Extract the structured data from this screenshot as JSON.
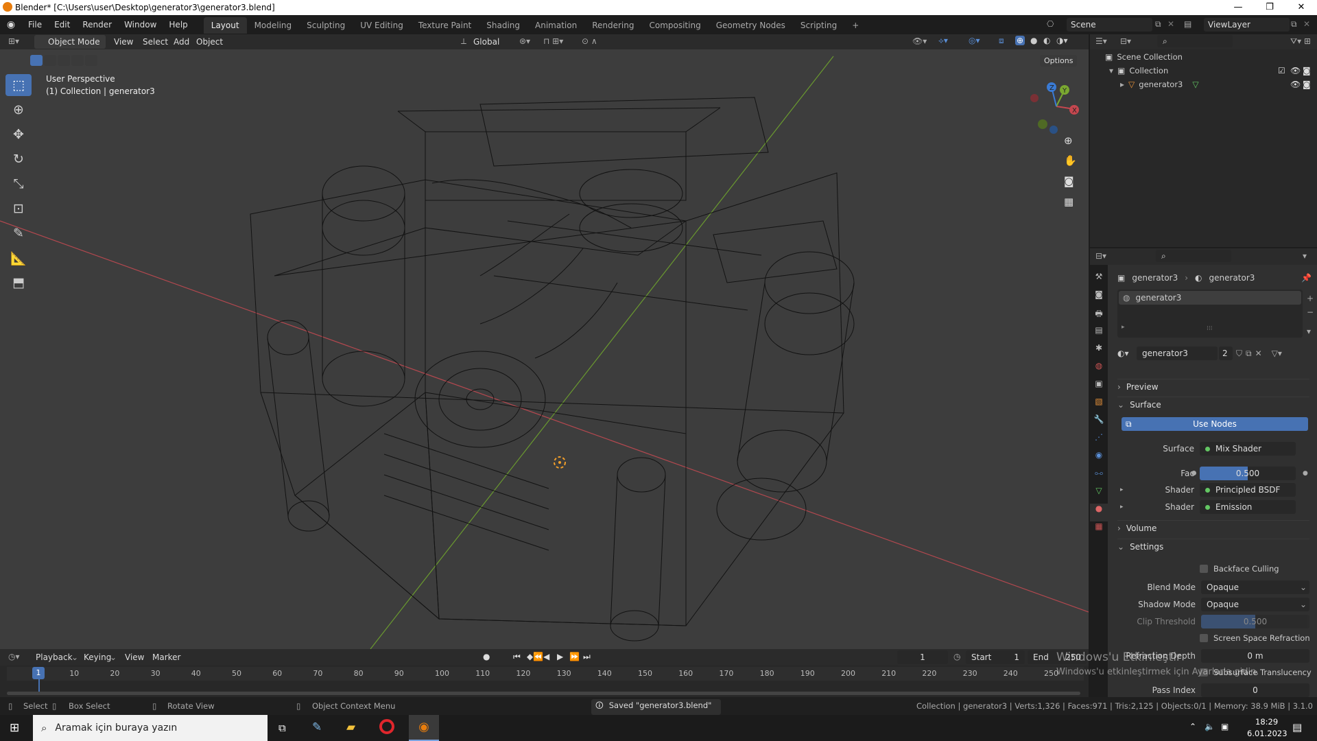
{
  "window": {
    "title": "Blender* [C:\\Users\\user\\Desktop\\generator3\\generator3.blend]"
  },
  "menu": [
    "File",
    "Edit",
    "Render",
    "Window",
    "Help"
  ],
  "workspaces": [
    "Layout",
    "Modeling",
    "Sculpting",
    "UV Editing",
    "Texture Paint",
    "Shading",
    "Animation",
    "Rendering",
    "Compositing",
    "Geometry Nodes",
    "Scripting"
  ],
  "active_workspace": "Layout",
  "scene": {
    "label": "Scene",
    "view_layer": "ViewLayer"
  },
  "viewport_header": {
    "mode": "Object Mode",
    "menus": [
      "View",
      "Select",
      "Add",
      "Object"
    ],
    "orientation": "Global",
    "options": "Options"
  },
  "viewport": {
    "perspective": "User Perspective",
    "collection_info": "(1) Collection | generator3"
  },
  "gizmo": {
    "x": "X",
    "y": "Y",
    "z": "Z"
  },
  "outliner": {
    "root": "Scene Collection",
    "collection": "Collection",
    "object": "generator3"
  },
  "properties": {
    "breadcrumb": [
      "generator3",
      "generator3"
    ],
    "slot": "generator3",
    "material": {
      "name": "generator3",
      "users": "2"
    },
    "sections": {
      "preview": "Preview",
      "surface": "Surface",
      "volume": "Volume",
      "settings": "Settings"
    },
    "use_nodes": "Use Nodes",
    "surface": {
      "label": "Surface",
      "value": "Mix Shader"
    },
    "fac": {
      "label": "Fac",
      "value": "0.500"
    },
    "shader1": {
      "label": "Shader",
      "value": "Principled BSDF"
    },
    "shader2": {
      "label": "Shader",
      "value": "Emission"
    },
    "backface": "Backface Culling",
    "blend_mode": {
      "label": "Blend Mode",
      "value": "Opaque"
    },
    "shadow_mode": {
      "label": "Shadow Mode",
      "value": "Opaque"
    },
    "clip": {
      "label": "Clip Threshold",
      "value": "0.500"
    },
    "ssr": "Screen Space Refraction",
    "refraction_depth": {
      "label": "Refraction Depth",
      "value": "0 m"
    },
    "sss": "Subsurface Translucency",
    "pass_index": {
      "label": "Pass Index",
      "value": "0"
    }
  },
  "timeline": {
    "menus": [
      "Playback",
      "Keying",
      "View",
      "Marker"
    ],
    "current_frame": "1",
    "start_label": "Start",
    "start": "1",
    "end_label": "End",
    "end": "250",
    "ticks": [
      "10",
      "20",
      "30",
      "40",
      "50",
      "60",
      "70",
      "80",
      "90",
      "100",
      "110",
      "120",
      "130",
      "140",
      "150",
      "160",
      "170",
      "180",
      "190",
      "200",
      "210",
      "220",
      "230",
      "240",
      "250"
    ],
    "playhead": "1"
  },
  "status": {
    "select": "Select",
    "box_select": "Box Select",
    "rotate": "Rotate View",
    "context": "Object Context Menu",
    "saved": "Saved \"generator3.blend\"",
    "stats": "Collection | generator3 | Verts:1,326 | Faces:971 | Tris:2,125 | Objects:0/1 | Memory: 38.9 MiB | 3.1.0"
  },
  "watermark": {
    "line1": "Windows'u Etkinleştir",
    "line2": "Windows'u etkinleştirmek için Ayarlar'a gidin."
  },
  "taskbar": {
    "search_placeholder": "Aramak için buraya yazın",
    "time": "18:29",
    "date": "6.01.2023"
  },
  "colors": {
    "accent": "#4772b3",
    "x_axis": "#c5474f",
    "y_axis": "#7aa830",
    "z_axis": "#3a7bd5"
  }
}
